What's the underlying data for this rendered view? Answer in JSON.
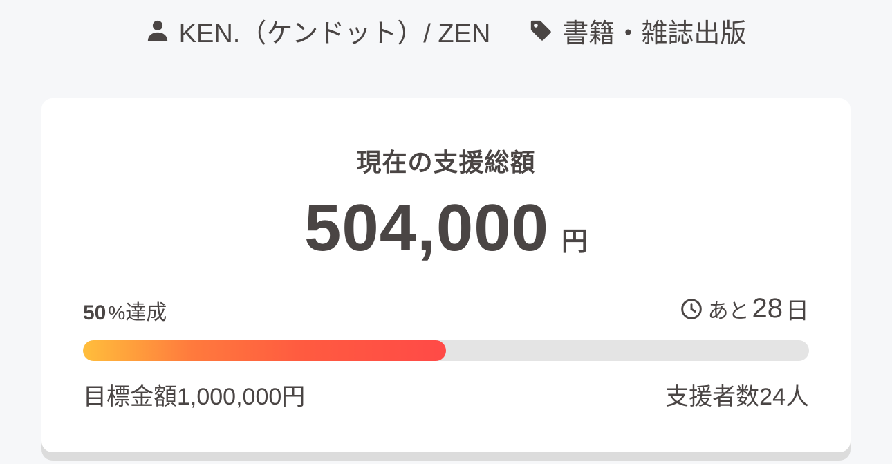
{
  "meta": {
    "author": "KEN.（ケンドット）/ ZEN",
    "category": "書籍・雑誌出版",
    "author_icon": "user-icon",
    "category_icon": "tag-icon"
  },
  "funding": {
    "title": "現在の支援総額",
    "amount": "504,000",
    "currency": "円",
    "percent_number": "50",
    "percent_sign": "%",
    "percent_word": "達成",
    "progress_fraction": 0.5,
    "remaining_prefix": "あと",
    "remaining_days": "28",
    "remaining_unit": "日",
    "goal_label": "目標金額1,000,000円",
    "supporters_label": "支援者数24人",
    "clock_icon": "clock-icon"
  },
  "colors": {
    "background": "#f6f7f9",
    "card": "#ffffff",
    "text": "#4a4544",
    "progress_track": "#e4e4e4",
    "progress_start": "#ffbe3c",
    "progress_end": "#ff4a47"
  }
}
